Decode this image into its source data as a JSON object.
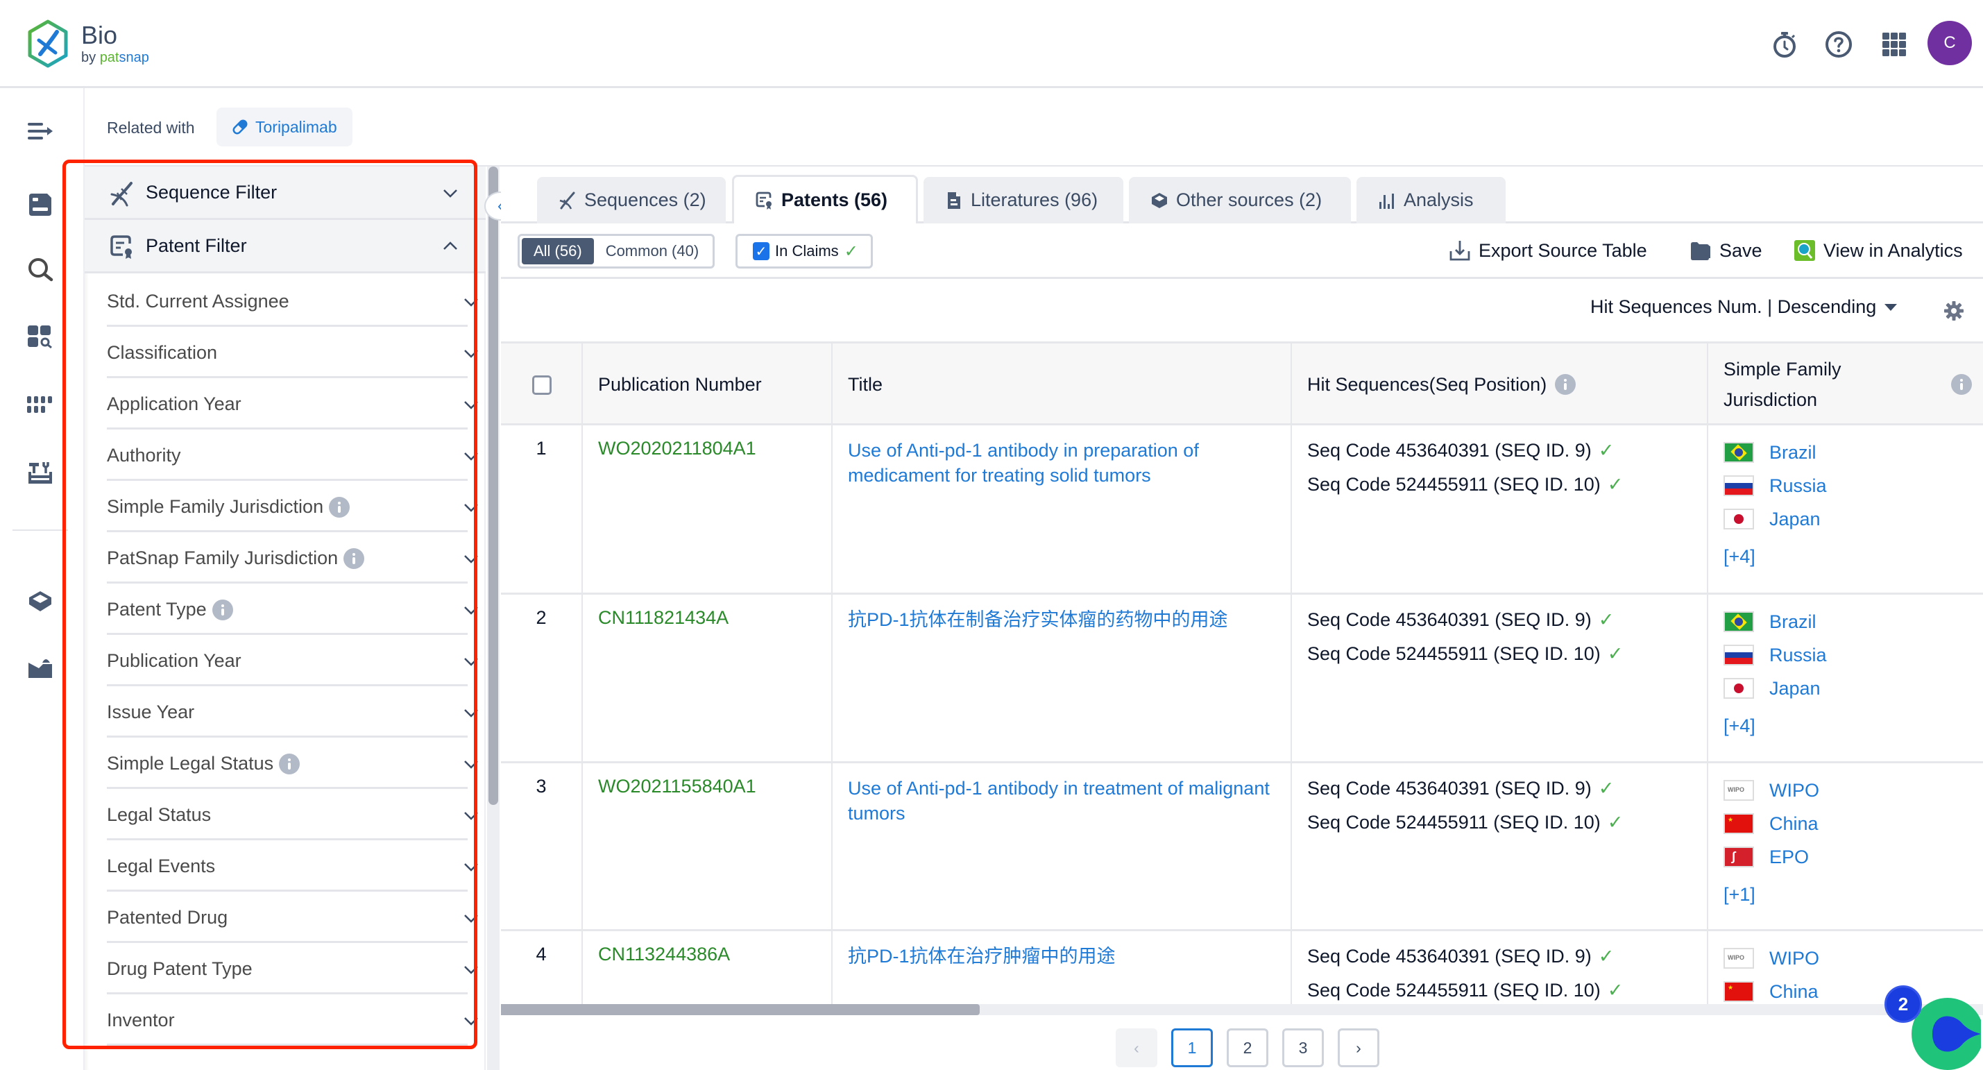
{
  "header": {
    "brand_title": "Bio",
    "brand_by": "by ",
    "brand_pat": "pat",
    "brand_snap": "snap",
    "icons": [
      "stopwatch-icon",
      "help-icon",
      "apps-grid-icon"
    ],
    "avatar_initial": "C",
    "avatar_color": "#7030a0"
  },
  "rail": {
    "items": [
      "menu-expand-icon",
      "workspace-icon",
      "search-icon",
      "analysis-search-icon",
      "sequence-grid-icon",
      "lab-tools-icon",
      "database-icon",
      "inbox-upload-icon"
    ]
  },
  "related": {
    "label": "Related with",
    "chip": "Toripalimab",
    "chip_icon": "pill-icon"
  },
  "filters": {
    "sections": [
      {
        "label": "Sequence Filter",
        "icon": "dna-icon",
        "expanded": false
      },
      {
        "label": "Patent Filter",
        "icon": "patent-icon",
        "expanded": true
      }
    ],
    "items": [
      {
        "label": "Std. Current Assignee",
        "info": false
      },
      {
        "label": "Classification",
        "info": false
      },
      {
        "label": "Application Year",
        "info": false
      },
      {
        "label": "Authority",
        "info": false
      },
      {
        "label": "Simple Family Jurisdiction",
        "info": true
      },
      {
        "label": "PatSnap Family Jurisdiction",
        "info": true
      },
      {
        "label": "Patent Type",
        "info": true
      },
      {
        "label": "Publication Year",
        "info": false
      },
      {
        "label": "Issue Year",
        "info": false
      },
      {
        "label": "Simple Legal Status",
        "info": true
      },
      {
        "label": "Legal Status",
        "info": false
      },
      {
        "label": "Legal Events",
        "info": false
      },
      {
        "label": "Patented Drug",
        "info": false
      },
      {
        "label": "Drug Patent Type",
        "info": false
      },
      {
        "label": "Inventor",
        "info": false
      }
    ]
  },
  "tabs": [
    {
      "label": "Sequences (2)",
      "icon": "dna-icon",
      "active": false
    },
    {
      "label": "Patents (56)",
      "icon": "patent-icon",
      "active": true
    },
    {
      "label": "Literatures (96)",
      "icon": "document-icon",
      "active": false
    },
    {
      "label": "Other sources (2)",
      "icon": "box-icon",
      "active": false
    },
    {
      "label": "Analysis",
      "icon": "bar-chart-icon",
      "active": false
    }
  ],
  "toolbar": {
    "segments": [
      {
        "label": "All (56)",
        "active": true
      },
      {
        "label": "Common (40)",
        "active": false
      }
    ],
    "in_claims_label": "In Claims",
    "in_claims_checked": true,
    "export_label": "Export Source Table",
    "save_label": "Save",
    "analytics_label": "View in Analytics"
  },
  "sort": {
    "label": "Hit Sequences Num. | Descending"
  },
  "table": {
    "columns": [
      "",
      "Publication Number",
      "Title",
      "Hit Sequences(Seq Position)",
      "Simple Family Jurisdiction"
    ],
    "rows": [
      {
        "num": "1",
        "pub": "WO2020211804A1",
        "title": "Use of Anti-pd-1 antibody in preparation of medicament for treating solid tumors",
        "seqs": [
          "Seq Code 453640391 (SEQ ID. 9)",
          "Seq Code 524455911 (SEQ ID. 10)"
        ],
        "jur": [
          "Brazil",
          "Russia",
          "Japan"
        ],
        "more": "[+4]"
      },
      {
        "num": "2",
        "pub": "CN111821434A",
        "title": "抗PD-1抗体在制备治疗实体瘤的药物中的用途",
        "seqs": [
          "Seq Code 453640391 (SEQ ID. 9)",
          "Seq Code 524455911 (SEQ ID. 10)"
        ],
        "jur": [
          "Brazil",
          "Russia",
          "Japan"
        ],
        "more": "[+4]"
      },
      {
        "num": "3",
        "pub": "WO2021155840A1",
        "title": "Use of Anti-pd-1 antibody in treatment of malignant tumors",
        "seqs": [
          "Seq Code 453640391 (SEQ ID. 9)",
          "Seq Code 524455911 (SEQ ID. 10)"
        ],
        "jur": [
          "WIPO",
          "China",
          "EPO"
        ],
        "more": "[+1]"
      },
      {
        "num": "4",
        "pub": "CN113244386A",
        "title": "抗PD-1抗体在治疗肿瘤中的用途",
        "seqs": [
          "Seq Code 453640391 (SEQ ID. 9)",
          "Seq Code 524455911 (SEQ ID. 10)"
        ],
        "jur": [
          "WIPO",
          "China"
        ],
        "more": ""
      }
    ]
  },
  "pagination": {
    "prev": "‹",
    "pages": [
      "1",
      "2",
      "3"
    ],
    "current": "1",
    "next": "›"
  },
  "assistant": {
    "badge_count": "2"
  },
  "colors": {
    "accent": "#1f7ad6",
    "pub_green": "#2a8a2a",
    "highlight_red": "#ff2200",
    "check_green": "#4caf50"
  }
}
